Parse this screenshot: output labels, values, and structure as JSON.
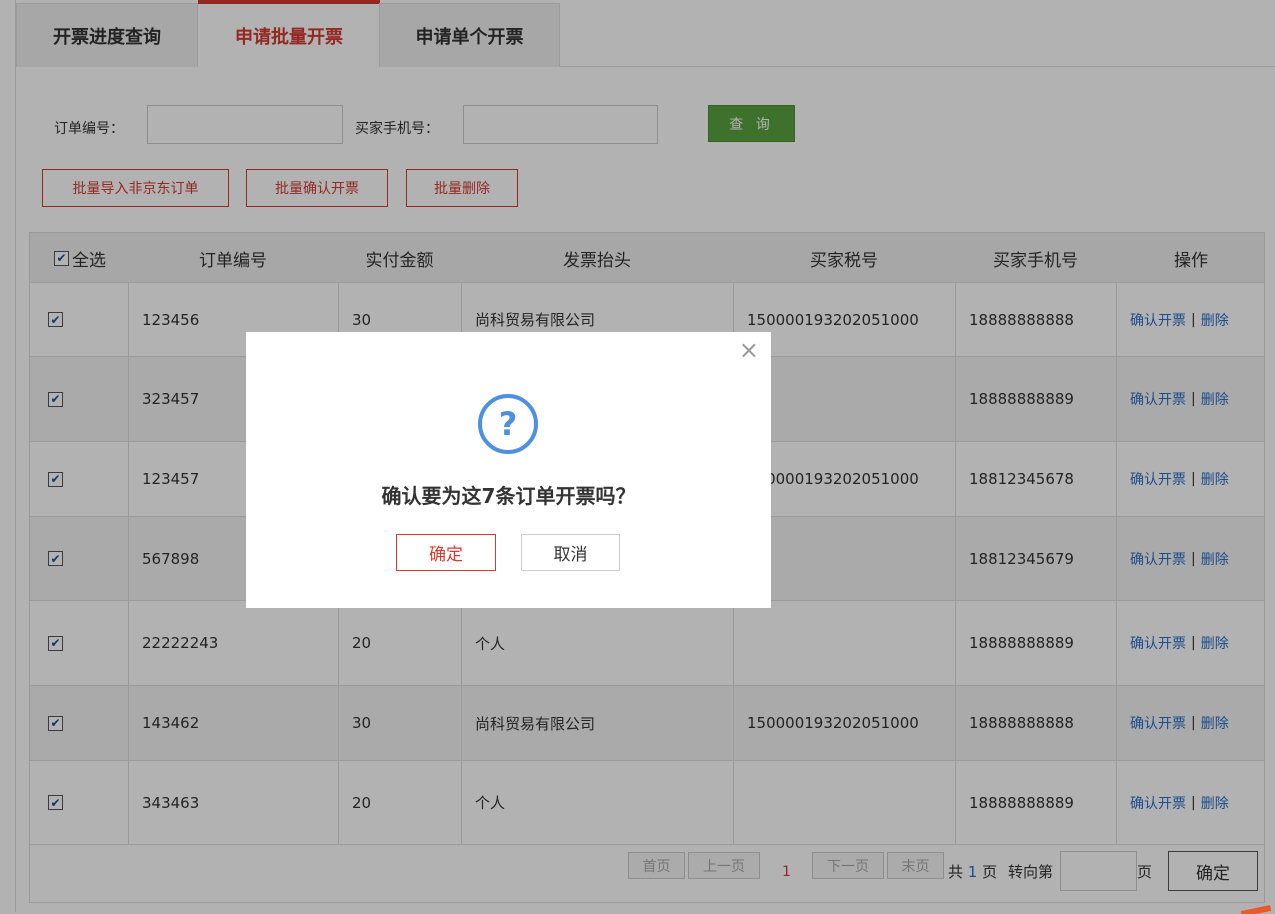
{
  "tabs": [
    {
      "label": "开票进度查询"
    },
    {
      "label": "申请批量开票"
    },
    {
      "label": "申请单个开票"
    }
  ],
  "search": {
    "order_label": "订单编号：",
    "order_value": "",
    "phone_label": "买家手机号：",
    "phone_value": "",
    "query_button": "查 询"
  },
  "actions": {
    "import_button": "批量导入非京东订单",
    "confirm_button": "批量确认开票",
    "delete_button": "批量删除"
  },
  "table": {
    "headers": [
      "全选",
      "订单编号",
      "实付金额",
      "发票抬头",
      "买家税号",
      "买家手机号",
      "操作"
    ],
    "action_confirm": "确认开票",
    "action_sep": "|",
    "action_delete": "删除",
    "rows": [
      {
        "order": "123456",
        "amount": "30",
        "title": "尚科贸易有限公司",
        "tax": "150000193202051000",
        "phone": "18888888888"
      },
      {
        "order": "323457",
        "amount": "",
        "title": "",
        "tax": "",
        "phone": "18888888889"
      },
      {
        "order": "123457",
        "amount": "",
        "title": "",
        "tax": "150000193202051000",
        "phone": "18812345678"
      },
      {
        "order": "567898",
        "amount": "",
        "title": "",
        "tax": "",
        "phone": "18812345679"
      },
      {
        "order": "22222243",
        "amount": "20",
        "title": "个人",
        "tax": "",
        "phone": "18888888889"
      },
      {
        "order": "143462",
        "amount": "30",
        "title": "尚科贸易有限公司",
        "tax": "150000193202051000",
        "phone": "18888888888"
      },
      {
        "order": "343463",
        "amount": "20",
        "title": "个人",
        "tax": "",
        "phone": "18888888889"
      }
    ]
  },
  "pager": {
    "first": "首页",
    "prev": "上一页",
    "current": "1",
    "next": "下一页",
    "last": "末页",
    "total_prefix": "共",
    "total": "1",
    "total_suffix": "页",
    "goto_label": "转向第",
    "goto_value": "",
    "goto_suffix": "页",
    "go_button": "确定"
  },
  "dialog": {
    "close": "×",
    "icon": "?",
    "message": "确认要为这7条订单开票吗？",
    "ok": "确定",
    "cancel": "取消"
  },
  "colors": {
    "accent_red": "#d33b32",
    "query_green": "#5aa33e",
    "link_blue": "#2a6fc9",
    "icon_blue": "#4e8fdf"
  }
}
